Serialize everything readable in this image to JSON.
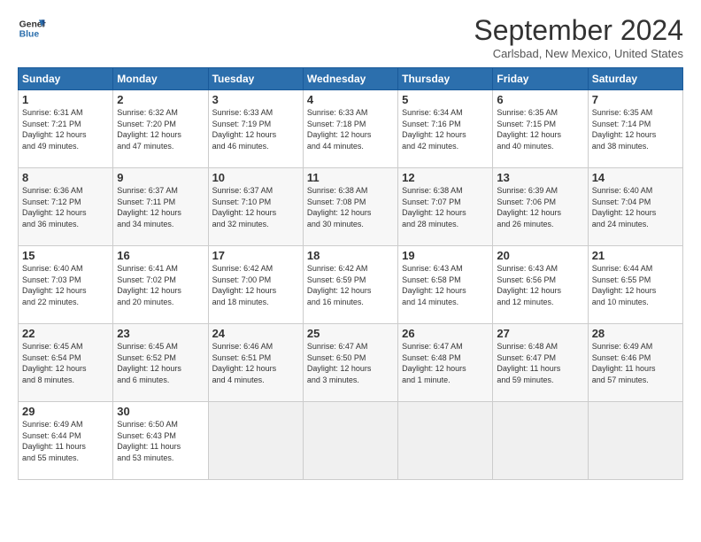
{
  "header": {
    "logo_line1": "General",
    "logo_line2": "Blue",
    "month": "September 2024",
    "location": "Carlsbad, New Mexico, United States"
  },
  "weekdays": [
    "Sunday",
    "Monday",
    "Tuesday",
    "Wednesday",
    "Thursday",
    "Friday",
    "Saturday"
  ],
  "weeks": [
    [
      {
        "day": "1",
        "info": "Sunrise: 6:31 AM\nSunset: 7:21 PM\nDaylight: 12 hours\nand 49 minutes."
      },
      {
        "day": "2",
        "info": "Sunrise: 6:32 AM\nSunset: 7:20 PM\nDaylight: 12 hours\nand 47 minutes."
      },
      {
        "day": "3",
        "info": "Sunrise: 6:33 AM\nSunset: 7:19 PM\nDaylight: 12 hours\nand 46 minutes."
      },
      {
        "day": "4",
        "info": "Sunrise: 6:33 AM\nSunset: 7:18 PM\nDaylight: 12 hours\nand 44 minutes."
      },
      {
        "day": "5",
        "info": "Sunrise: 6:34 AM\nSunset: 7:16 PM\nDaylight: 12 hours\nand 42 minutes."
      },
      {
        "day": "6",
        "info": "Sunrise: 6:35 AM\nSunset: 7:15 PM\nDaylight: 12 hours\nand 40 minutes."
      },
      {
        "day": "7",
        "info": "Sunrise: 6:35 AM\nSunset: 7:14 PM\nDaylight: 12 hours\nand 38 minutes."
      }
    ],
    [
      {
        "day": "8",
        "info": "Sunrise: 6:36 AM\nSunset: 7:12 PM\nDaylight: 12 hours\nand 36 minutes."
      },
      {
        "day": "9",
        "info": "Sunrise: 6:37 AM\nSunset: 7:11 PM\nDaylight: 12 hours\nand 34 minutes."
      },
      {
        "day": "10",
        "info": "Sunrise: 6:37 AM\nSunset: 7:10 PM\nDaylight: 12 hours\nand 32 minutes."
      },
      {
        "day": "11",
        "info": "Sunrise: 6:38 AM\nSunset: 7:08 PM\nDaylight: 12 hours\nand 30 minutes."
      },
      {
        "day": "12",
        "info": "Sunrise: 6:38 AM\nSunset: 7:07 PM\nDaylight: 12 hours\nand 28 minutes."
      },
      {
        "day": "13",
        "info": "Sunrise: 6:39 AM\nSunset: 7:06 PM\nDaylight: 12 hours\nand 26 minutes."
      },
      {
        "day": "14",
        "info": "Sunrise: 6:40 AM\nSunset: 7:04 PM\nDaylight: 12 hours\nand 24 minutes."
      }
    ],
    [
      {
        "day": "15",
        "info": "Sunrise: 6:40 AM\nSunset: 7:03 PM\nDaylight: 12 hours\nand 22 minutes."
      },
      {
        "day": "16",
        "info": "Sunrise: 6:41 AM\nSunset: 7:02 PM\nDaylight: 12 hours\nand 20 minutes."
      },
      {
        "day": "17",
        "info": "Sunrise: 6:42 AM\nSunset: 7:00 PM\nDaylight: 12 hours\nand 18 minutes."
      },
      {
        "day": "18",
        "info": "Sunrise: 6:42 AM\nSunset: 6:59 PM\nDaylight: 12 hours\nand 16 minutes."
      },
      {
        "day": "19",
        "info": "Sunrise: 6:43 AM\nSunset: 6:58 PM\nDaylight: 12 hours\nand 14 minutes."
      },
      {
        "day": "20",
        "info": "Sunrise: 6:43 AM\nSunset: 6:56 PM\nDaylight: 12 hours\nand 12 minutes."
      },
      {
        "day": "21",
        "info": "Sunrise: 6:44 AM\nSunset: 6:55 PM\nDaylight: 12 hours\nand 10 minutes."
      }
    ],
    [
      {
        "day": "22",
        "info": "Sunrise: 6:45 AM\nSunset: 6:54 PM\nDaylight: 12 hours\nand 8 minutes."
      },
      {
        "day": "23",
        "info": "Sunrise: 6:45 AM\nSunset: 6:52 PM\nDaylight: 12 hours\nand 6 minutes."
      },
      {
        "day": "24",
        "info": "Sunrise: 6:46 AM\nSunset: 6:51 PM\nDaylight: 12 hours\nand 4 minutes."
      },
      {
        "day": "25",
        "info": "Sunrise: 6:47 AM\nSunset: 6:50 PM\nDaylight: 12 hours\nand 3 minutes."
      },
      {
        "day": "26",
        "info": "Sunrise: 6:47 AM\nSunset: 6:48 PM\nDaylight: 12 hours\nand 1 minute."
      },
      {
        "day": "27",
        "info": "Sunrise: 6:48 AM\nSunset: 6:47 PM\nDaylight: 11 hours\nand 59 minutes."
      },
      {
        "day": "28",
        "info": "Sunrise: 6:49 AM\nSunset: 6:46 PM\nDaylight: 11 hours\nand 57 minutes."
      }
    ],
    [
      {
        "day": "29",
        "info": "Sunrise: 6:49 AM\nSunset: 6:44 PM\nDaylight: 11 hours\nand 55 minutes."
      },
      {
        "day": "30",
        "info": "Sunrise: 6:50 AM\nSunset: 6:43 PM\nDaylight: 11 hours\nand 53 minutes."
      },
      null,
      null,
      null,
      null,
      null
    ]
  ]
}
